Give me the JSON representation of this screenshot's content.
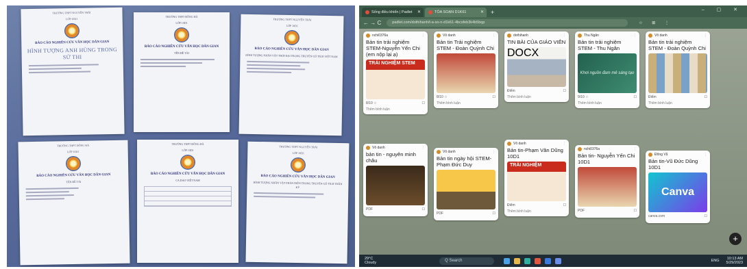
{
  "left_photo": {
    "sheets": [
      {
        "school": "TRƯỜNG THPT NGUYỄN TRÃI",
        "class": "LỚP 10D1",
        "title": "BÁO CÁO NGHIÊN CỨU VĂN HỌC DÂN GIAN",
        "topic": "HÌNH TƯỢNG ANH HÙNG TRONG SỬ THI"
      },
      {
        "school": "TRƯỜNG THPT ĐÔNG HÀ",
        "class": "LỚP 10D1",
        "title": "BÁO CÁO NGHIÊN CỨU VĂN HỌC DÂN GIAN",
        "topic": "TÊN ĐỀ TÀI"
      },
      {
        "school": "TRƯỜNG THPT NGUYỄN TRÃI",
        "class": "LỚP 10D1",
        "title": "BÁO CÁO NGHIÊN CỨU VĂN HỌC DÂN GIAN",
        "topic": "HÌNH TƯỢNG NHÂN VẬT THỜI ĐẠI TRONG TRUYỆN CỔ TÍCH VIỆT NAM"
      },
      {
        "school": "TRƯỜNG THPT ĐÔNG HÀ",
        "class": "LỚP 10D1",
        "title": "BÁO CÁO NGHIÊN CỨU VĂN HỌC DÂN GIAN",
        "topic": "TÊN ĐỀ TÀI"
      },
      {
        "school": "TRƯỜNG THPT ĐÔNG HÀ",
        "class": "LỚP 10D1",
        "title": "BÁO CÁO NGHIÊN CỨU VĂN HỌC DÂN GIAN",
        "topic": "CA DAO VIỆT NAM"
      },
      {
        "school": "TRƯỜNG THPT NGUYỄN TRÃI",
        "class": "LỚP 10D1",
        "title": "BÁO CÁO NGHIÊN CỨU VĂN HỌC DÂN GIAN",
        "topic": "HÌNH TƯỢNG NHÂN VẬT PHẢN DIỆN TRONG TRUYỆN CỔ TÍCH THẦN KỲ"
      }
    ]
  },
  "browser": {
    "tabs": [
      {
        "label": "Sống điều khiển | Padlet",
        "active": false
      },
      {
        "label": "TÒA SOẠN D1K61",
        "active": true
      }
    ],
    "new_tab": "+",
    "window_controls": "– ▢ ✕",
    "nav": "← → C",
    "url": "padlet.com/dothihanh/t-a-so-n-d1k61-4bcsfeb3k4b5bqp",
    "tools": "☆ ⊞ ⋮"
  },
  "padlet": {
    "columns": [
      [
        {
          "author": "nchi0376a",
          "title": "Bản tin trải nghiệm STEM-Nguyễn Yến Chi (em nộp lại ạ)",
          "img": "red",
          "img_label": "TRẢI NGHIỆM STEM",
          "footer": "8/10 ☆",
          "comments": "Thêm bình luận"
        },
        {
          "author": "Vô danh",
          "title": "bản tin - nguyên minh châu",
          "img": "dark",
          "img_label": "",
          "footer": "PDF",
          "comments": ""
        }
      ],
      [
        {
          "author": "Vô danh",
          "title": "Bản tin Trải nghiệm STEM - Đoàn Quỳnh Chi",
          "img": "photo2",
          "img_label": "",
          "footer": "8/10 ☆",
          "comments": "Thêm bình luận"
        },
        {
          "author": "Vô danh",
          "title": "Bản tin ngày hội STEM-Phạm Đức Duy",
          "img": "yellow",
          "img_label": "",
          "footer": "PDF",
          "comments": ""
        }
      ],
      [
        {
          "author": "dothihanh",
          "title": "TIN BÀI CỦA GIÁO VIÊN",
          "img": "build",
          "img_label": "DOCX",
          "footer": "Điểm",
          "comments": "Thêm bình luận"
        },
        {
          "author": "Vô danh",
          "title": "Bản tin-Phạm Văn Dũng 10D1",
          "img": "red",
          "img_label": "TRẢI NGHIỆM",
          "footer": "Điểm",
          "comments": "Thêm bình luận"
        }
      ],
      [
        {
          "author": "Thu Ngân",
          "title": "Bản tin trải nghiệm STEM - Thu Ngân",
          "img": "green",
          "img_label": "Khơi nguồn đam mê sáng tạo",
          "footer": "9/10 ☆",
          "comments": "Thêm bình luận"
        },
        {
          "author": "nchi0376a",
          "title": "Bản tin- Nguyễn Yến Chi 10D1",
          "img": "photo2",
          "img_label": "",
          "footer": "PDF",
          "comments": ""
        }
      ],
      [
        {
          "author": "Vô danh",
          "title": "Bản tin trải nghiệm STEM - Đoàn Quỳnh Chi",
          "img": "doc",
          "img_label": "",
          "footer": "Điểm",
          "comments": "Thêm bình luận"
        },
        {
          "author": "Đông Vũ",
          "title": "Bản tin-Vũ Đức Dũng 10D1",
          "img": "canva",
          "img_label": "Canva",
          "footer": "canva.com",
          "comments": ""
        }
      ]
    ],
    "fab": "+"
  },
  "taskbar": {
    "weather_temp": "29°C",
    "weather_desc": "Cloudy",
    "search": "Q Search",
    "lang": "ENG",
    "time": "10:13 AM",
    "date": "5/29/2023"
  }
}
